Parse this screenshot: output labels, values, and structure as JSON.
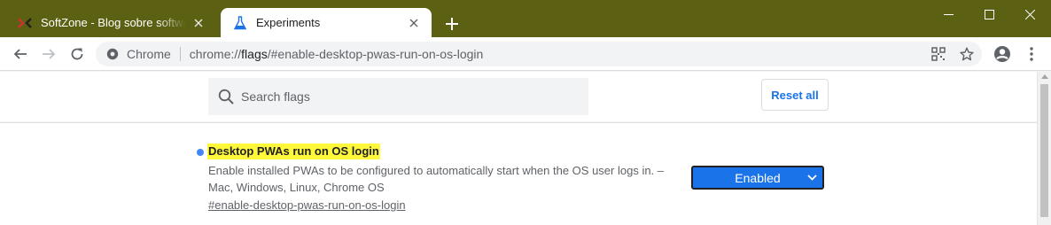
{
  "browser": {
    "tabs": [
      {
        "title": "SoftZone - Blog sobre software, trucos y",
        "active": false,
        "favicon": "softzone-icon"
      },
      {
        "title": "Experiments",
        "active": true,
        "favicon": "flask-icon"
      }
    ],
    "omnibox": {
      "chip": "Chrome",
      "url_prefix": "chrome://",
      "url_bold": "flags",
      "url_suffix": "/#enable-desktop-pwas-run-on-os-login"
    }
  },
  "flags_page": {
    "search_placeholder": "Search flags",
    "reset_label": "Reset all",
    "flag": {
      "name": "Desktop PWAs run on OS login",
      "description": "Enable installed PWAs to be configured to automatically start when the OS user logs in. – Mac, Windows, Linux, Chrome OS",
      "link": "#enable-desktop-pwas-run-on-os-login",
      "selected_option": "Enabled"
    }
  },
  "colors": {
    "titlebar": "#5c6012",
    "accent": "#1a73e8",
    "highlight": "#fff83a"
  }
}
